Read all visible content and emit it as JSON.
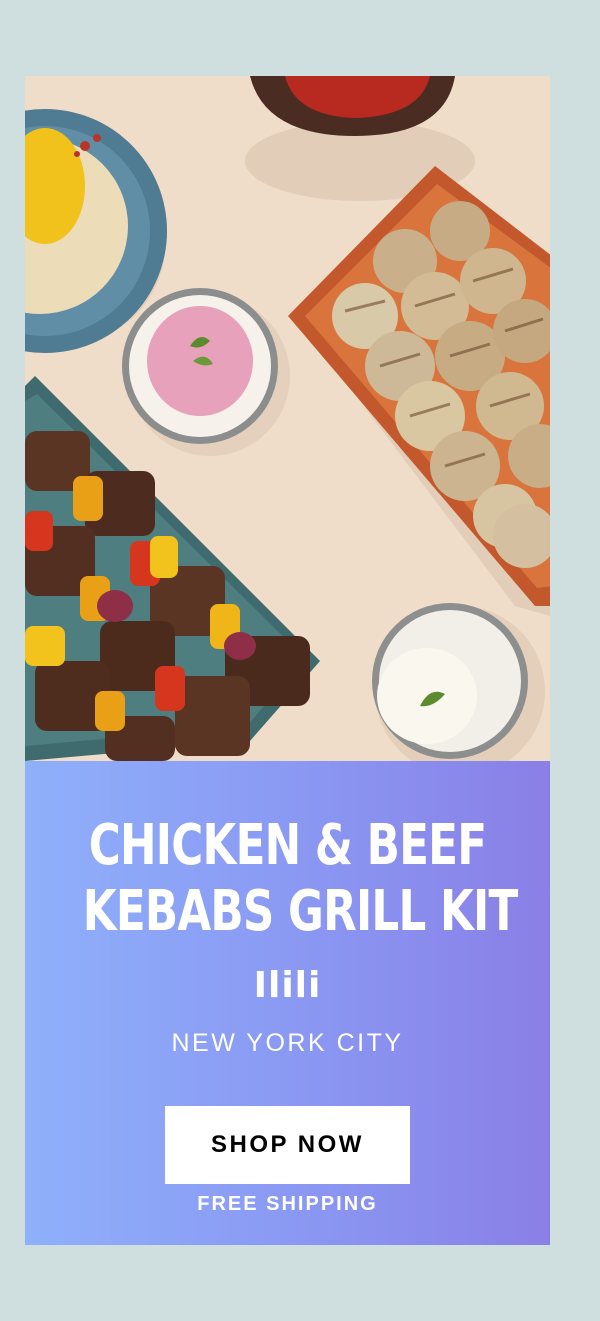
{
  "promo": {
    "image_alt": "Chicken and beef kebab skewers on platters with hummus, dips and sauces",
    "headline_line1": "CHICKEN & BEEF",
    "headline_line2": "KEBABS GRILL KIT",
    "brand": "Ilili",
    "location": "NEW YORK CITY",
    "cta_label": "SHOP NOW",
    "shipping_note": "FREE SHIPPING"
  },
  "colors": {
    "page_background": "#cfdede",
    "panel_gradient_start": "#8fb0fb",
    "panel_gradient_end": "#8a7fe6",
    "cta_background": "#ffffff",
    "cta_text": "#000000"
  }
}
